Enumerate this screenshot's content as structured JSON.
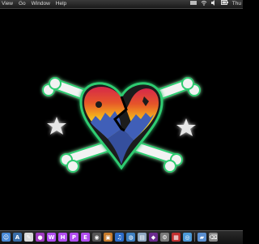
{
  "menubar": {
    "items": [
      "View",
      "Go",
      "Window",
      "Help"
    ],
    "clock": "Thu"
  },
  "status_icons": [
    "app-status-icon",
    "wifi-icon",
    "volume-icon",
    "battery-icon"
  ],
  "dock": {
    "icons": [
      {
        "name": "finder",
        "glyph": "☺",
        "color": "#4a8ad6"
      },
      {
        "name": "app-store",
        "glyph": "A",
        "color": "#3b6ea8"
      },
      {
        "name": "textedit",
        "glyph": "✎",
        "color": "#d9d9d9"
      },
      {
        "name": "color-picker",
        "glyph": "●",
        "color": "#a03cc0"
      },
      {
        "name": "app-w",
        "glyph": "W",
        "color": "#b04df0"
      },
      {
        "name": "app-h",
        "glyph": "H",
        "color": "#b04df0"
      },
      {
        "name": "app-p",
        "glyph": "P",
        "color": "#b04df0"
      },
      {
        "name": "app-e",
        "glyph": "E",
        "color": "#b04df0"
      },
      {
        "name": "camera",
        "glyph": "◉",
        "color": "#555"
      },
      {
        "name": "photos",
        "glyph": "▣",
        "color": "#c67a2c"
      },
      {
        "name": "music",
        "glyph": "♫",
        "color": "#2d6cc9"
      },
      {
        "name": "world",
        "glyph": "◍",
        "color": "#3f7fbf"
      },
      {
        "name": "preview",
        "glyph": "▤",
        "color": "#8fa7c0"
      },
      {
        "name": "media",
        "glyph": "◆",
        "color": "#6b2b8f"
      },
      {
        "name": "utilities",
        "glyph": "⚙",
        "color": "#7a7a7a"
      },
      {
        "name": "calendar",
        "glyph": "▦",
        "color": "#c03030"
      },
      {
        "name": "network",
        "glyph": "◎",
        "color": "#4c9ad8"
      },
      {
        "name": "applications-folder",
        "glyph": "▰",
        "color": "#5b8fd0"
      },
      {
        "name": "trash",
        "glyph": "⌫",
        "color": "#888"
      }
    ]
  },
  "colors": {
    "glow": "#2ecc71",
    "bone": "#f2f2f2",
    "heart_blue": "#3f5fb8"
  }
}
